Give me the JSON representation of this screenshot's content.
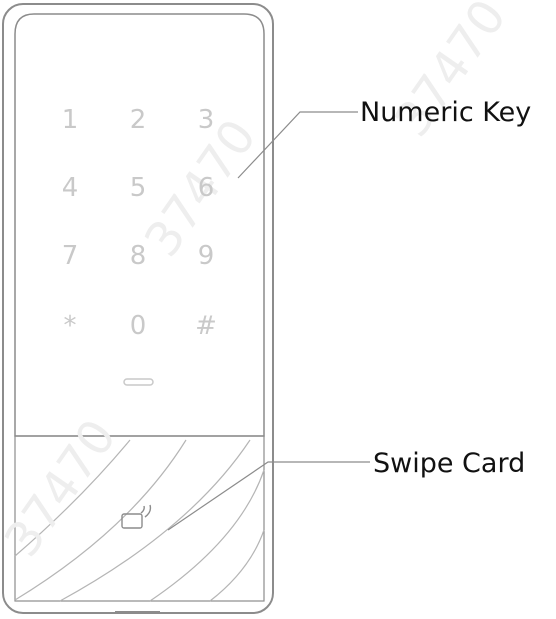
{
  "device": {
    "keypad": {
      "rows": [
        [
          "1",
          "2",
          "3"
        ],
        [
          "4",
          "5",
          "6"
        ],
        [
          "7",
          "8",
          "9"
        ],
        [
          "*",
          "0",
          "#"
        ]
      ]
    },
    "indicator_icon": "status-led-icon",
    "card_icon": "card-reader-icon"
  },
  "labels": {
    "numeric_key": "Numeric Key",
    "swipe_card": "Swipe Card"
  },
  "colors": {
    "outline": "#8c8c8c",
    "key_text": "#c9c9c9",
    "label_text": "#111111"
  }
}
